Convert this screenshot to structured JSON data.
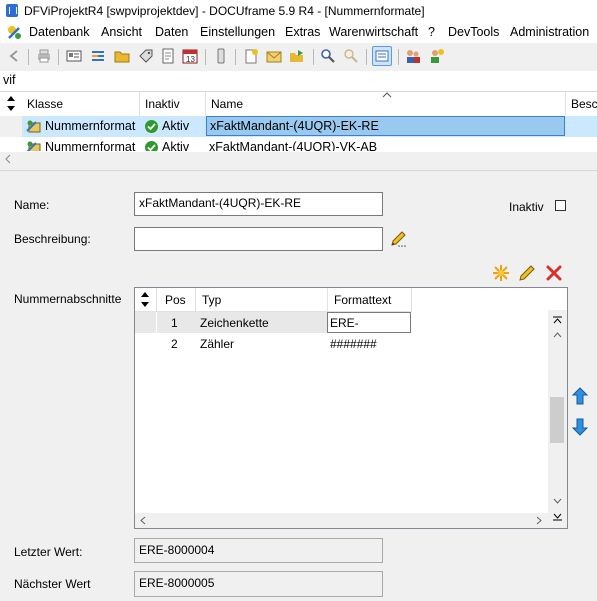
{
  "window": {
    "title": "DFViProjektR4 [swpviprojektdev] - DOCUframe 5.9 R4 - [Nummernformate]"
  },
  "menu": {
    "items": [
      "Datenbank",
      "Ansicht",
      "Daten",
      "Einstellungen",
      "Extras",
      "Warenwirtschaft",
      "?",
      "DevTools",
      "Administration"
    ]
  },
  "search": {
    "value": "vif"
  },
  "grid": {
    "columns": [
      "Klasse",
      "Inaktiv",
      "Name",
      "Besc"
    ],
    "rows": [
      {
        "klasse": "Nummernformat",
        "inaktiv": "Aktiv",
        "name": "xFaktMandant-(4UQR)-EK-RE"
      },
      {
        "klasse": "Nummernformat",
        "inaktiv": "Aktiv",
        "name": "xFaktMandant-(4UQR)-VK-AB"
      }
    ]
  },
  "form": {
    "name_label": "Name:",
    "name_value": "xFaktMandant-(4UQR)-EK-RE",
    "inaktiv_label": "Inaktiv",
    "beschreibung_label": "Beschreibung:",
    "beschreibung_value": "",
    "abschnitte_label": "Nummernabschnitte",
    "abschnitte": {
      "columns": [
        "Pos",
        "Typ",
        "Formattext"
      ],
      "rows": [
        {
          "pos": "1",
          "typ": "Zeichenkette",
          "formattext": "ERE-"
        },
        {
          "pos": "2",
          "typ": "Zähler",
          "formattext": "#######"
        }
      ]
    },
    "letzter_label": "Letzter Wert:",
    "letzter_value": "ERE-8000004",
    "naechster_label": "Nächster Wert",
    "naechster_value": "ERE-8000005"
  },
  "colors": {
    "selection": "#99c9ef",
    "accent": "#2a6fd1",
    "delete_red": "#d9302c",
    "arrow_blue": "#2f8fe0"
  }
}
